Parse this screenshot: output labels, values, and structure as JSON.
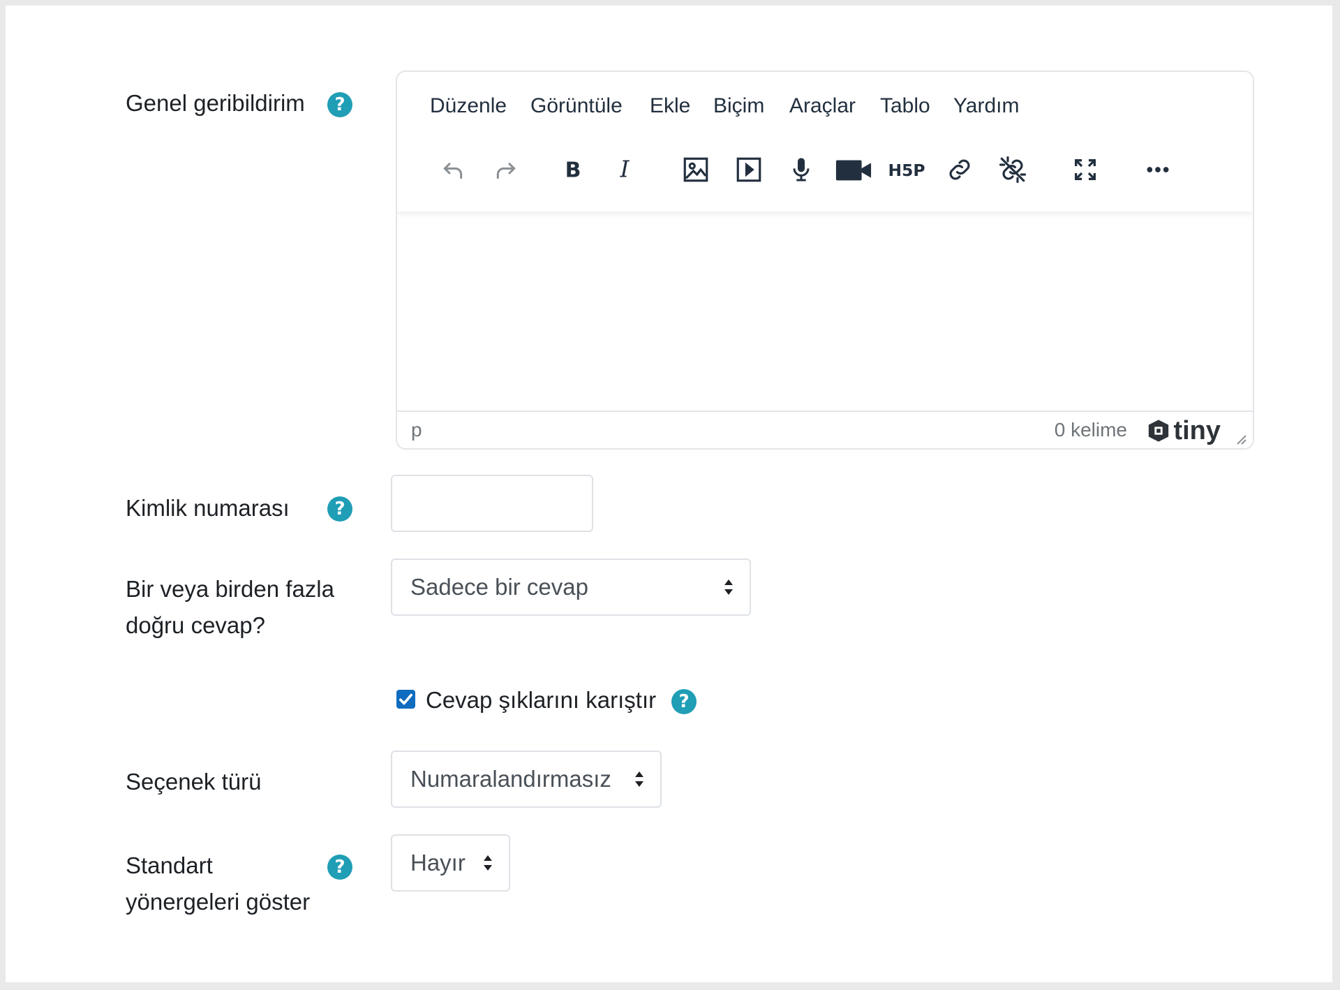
{
  "fields": {
    "general_feedback_label": "Genel geribildirim",
    "id_number_label": "Kimlik numarası",
    "single_answer_label": "Bir veya birden fazla doğru cevap?",
    "single_answer_value": "Sadece bir cevap",
    "shuffle_label": "Cevap şıklarını karıştır",
    "shuffle_checked": true,
    "numbering_label": "Seçenek türü",
    "numbering_value": "Numaralandırmasız",
    "show_instructions_label": "Standart yönergeleri göster",
    "show_instructions_value": "Hayır",
    "id_number_value": ""
  },
  "editor": {
    "menu": [
      "Düzenle",
      "Görüntüle",
      "Ekle",
      "Biçim",
      "Araçlar",
      "Tablo",
      "Yardım"
    ],
    "toolbar": [
      "undo-icon",
      "redo-icon",
      "bold-icon",
      "italic-icon",
      "image-icon",
      "media-icon",
      "microphone-icon",
      "video-camera-icon",
      "h5p-icon",
      "link-icon",
      "unlink-icon",
      "fullscreen-icon",
      "more-icon"
    ],
    "status_path": "p",
    "word_count": "0 kelime",
    "brand": "tiny"
  },
  "help_symbol": "?",
  "colors": {
    "help_icon": "#1f9eb5",
    "checkbox": "#0f6cbf",
    "border": "#dee2e6",
    "text": "#1d2125"
  }
}
